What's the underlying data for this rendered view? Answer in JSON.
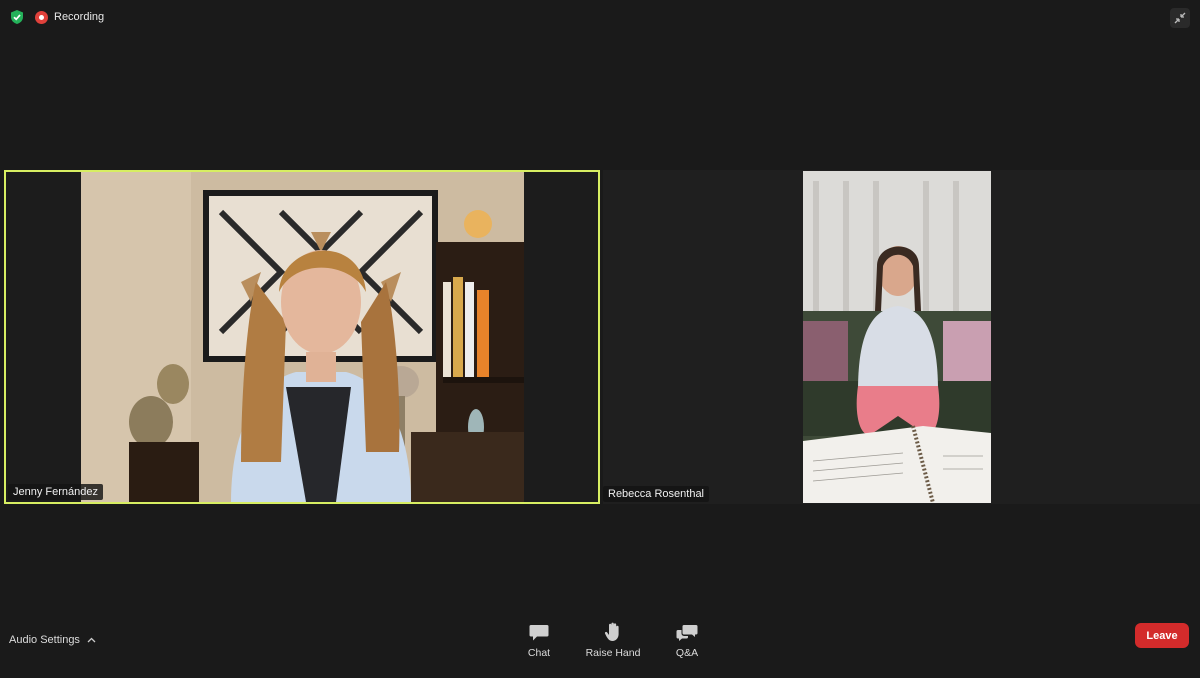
{
  "topbar": {
    "security_icon": "shield-check-icon",
    "recording_label": "Recording",
    "exit_fullscreen_icon": "exit-fullscreen-icon"
  },
  "participants": [
    {
      "name": "Jenny Fernández",
      "active_speaker": true,
      "speaker_color": "#d7ee62"
    },
    {
      "name": "Rebecca Rosenthal",
      "active_speaker": false
    }
  ],
  "controls": {
    "audio_settings_label": "Audio Settings",
    "chat_label": "Chat",
    "raise_hand_label": "Raise Hand",
    "qa_label": "Q&A",
    "leave_label": "Leave",
    "leave_color": "#d32b2b"
  }
}
